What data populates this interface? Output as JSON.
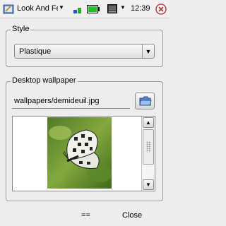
{
  "topbar": {
    "app_title": "Look And Feel",
    "clock": "12:39",
    "icons": {
      "app": "appearance-icon",
      "network": "network-status-icon",
      "battery": "battery-icon",
      "terminal": "terminal-icon",
      "close": "close-icon"
    },
    "colors": {
      "battery_fill": "#22c022",
      "close": "#d04040"
    }
  },
  "style": {
    "group_title": "Style",
    "selected": "Plastique"
  },
  "wallpaper": {
    "group_title": "Desktop wallpaper",
    "path": "wallpapers/demideuil.jpg",
    "browse_icon": "folder-open-icon",
    "preview_subject": "butterfly-photo"
  },
  "softkeys": {
    "left": "==",
    "right": "Close"
  }
}
